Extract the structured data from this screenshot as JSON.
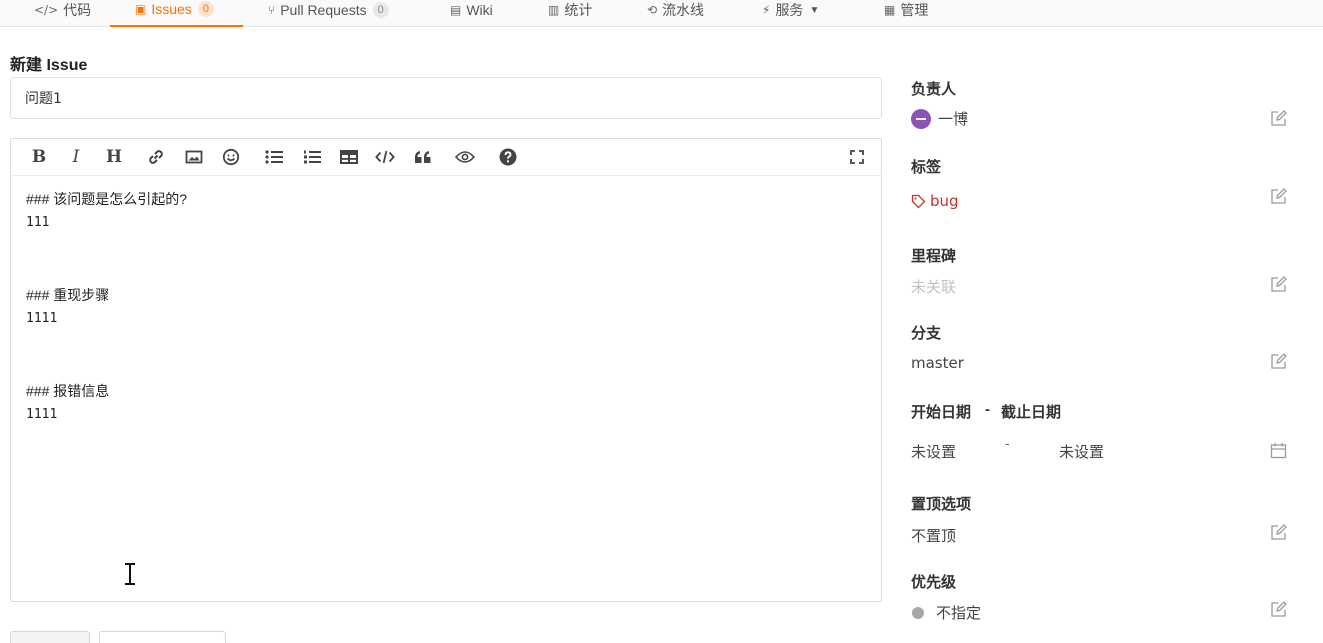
{
  "tabs": [
    {
      "label": "代码",
      "icon": "code-icon"
    },
    {
      "label": "Issues",
      "count": "0",
      "icon": "issue-icon"
    },
    {
      "label": "Pull Requests",
      "count": "0",
      "icon": "pull-request-icon"
    },
    {
      "label": "Wiki",
      "icon": "wiki-icon"
    },
    {
      "label": "统计",
      "icon": "chart-icon"
    },
    {
      "label": "流水线",
      "icon": "pipeline-icon"
    },
    {
      "label": "服务",
      "icon": "service-icon"
    },
    {
      "label": "管理",
      "icon": "settings-icon"
    }
  ],
  "active_tab": "Issues",
  "form": {
    "page_title": "新建 Issue",
    "title_value": "问题1"
  },
  "editor": {
    "toolbar": {
      "bold": "B",
      "italic": "I",
      "heading": "H"
    },
    "lines": [
      "### 该问题是怎么引起的?",
      "111",
      "",
      "",
      "### 重现步骤",
      "1111",
      "",
      "",
      "### 报错信息",
      "1111"
    ]
  },
  "sidebar": {
    "assignee": {
      "label": "负责人",
      "value": "一博"
    },
    "labels": {
      "label": "标签",
      "value": "bug"
    },
    "milestone": {
      "label": "里程碑",
      "value": "未关联"
    },
    "branch": {
      "label": "分支",
      "value": "master"
    },
    "dates": {
      "label_start": "开始日期",
      "separator": "-",
      "label_end": "截止日期",
      "start_value": "未设置",
      "end_value": "未设置"
    },
    "pin": {
      "label": "置顶选项",
      "value": "不置顶"
    },
    "priority": {
      "label": "优先级",
      "value": "不指定"
    }
  },
  "colors": {
    "accent": "#fe7300",
    "bug": "#c4342b",
    "avatar": "#8e54b5"
  }
}
